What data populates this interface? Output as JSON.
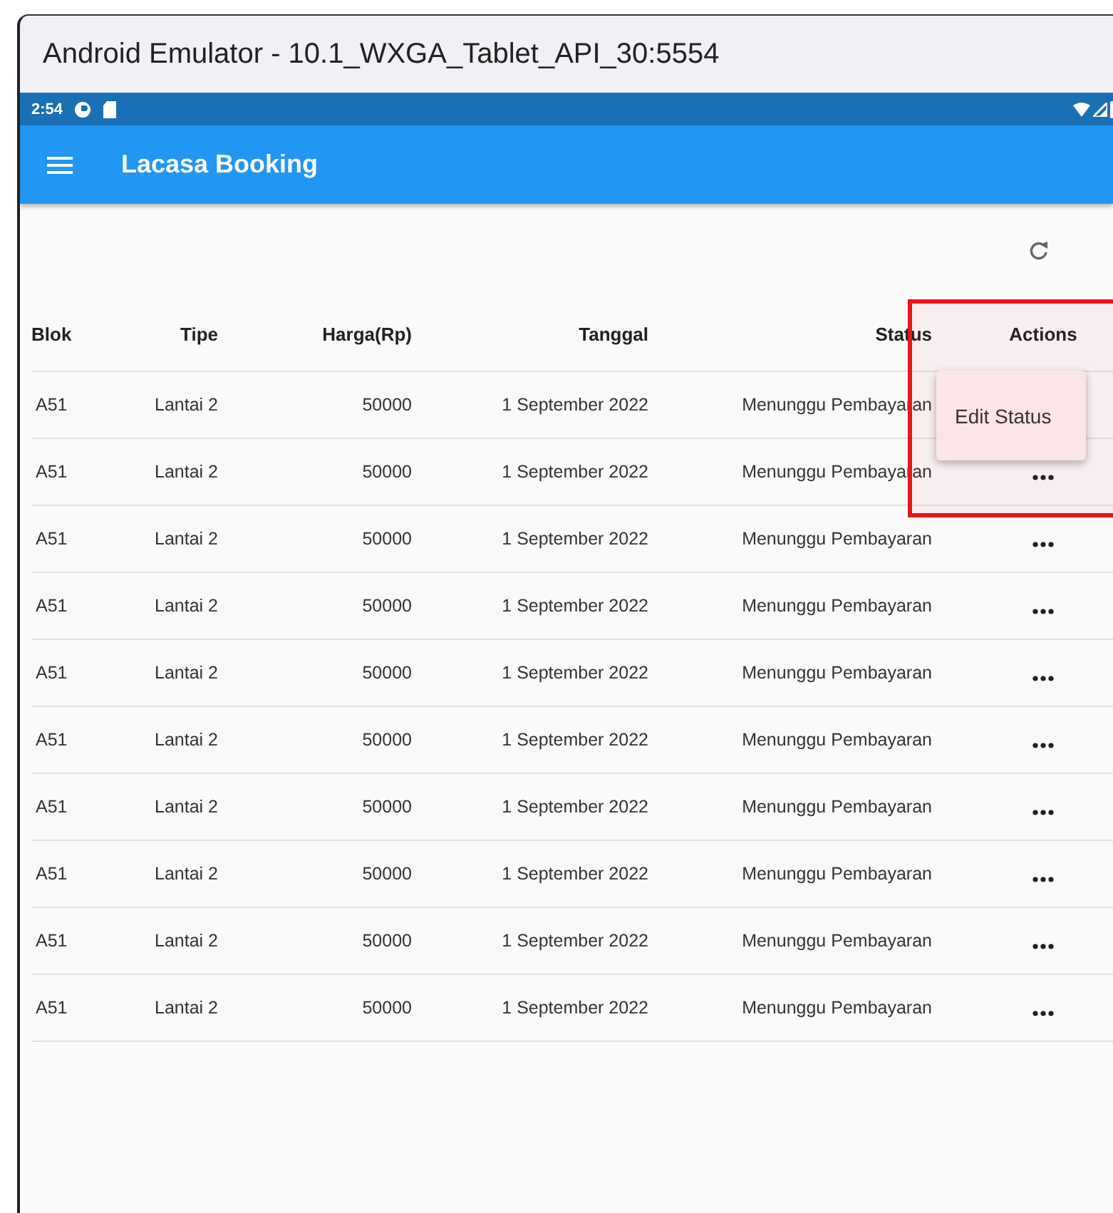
{
  "window": {
    "title": "Android Emulator - 10.1_WXGA_Tablet_API_30:5554"
  },
  "status_bar": {
    "time": "2:54"
  },
  "app_bar": {
    "title": "Lacasa Booking"
  },
  "table": {
    "columns": [
      "Blok",
      "Tipe",
      "Harga(Rp)",
      "Tanggal",
      "Status",
      "Actions"
    ],
    "rows": [
      {
        "cells": [
          "A51",
          "Lantai 2",
          "50000",
          "1 September 2022",
          "Menunggu Pembayaran"
        ],
        "menu_open": true
      },
      {
        "cells": [
          "A51",
          "Lantai 2",
          "50000",
          "1 September 2022",
          "Menunggu Pembayaran"
        ],
        "menu_open": false
      },
      {
        "cells": [
          "A51",
          "Lantai 2",
          "50000",
          "1 September 2022",
          "Menunggu Pembayaran"
        ],
        "menu_open": false
      },
      {
        "cells": [
          "A51",
          "Lantai 2",
          "50000",
          "1 September 2022",
          "Menunggu Pembayaran"
        ],
        "menu_open": false
      },
      {
        "cells": [
          "A51",
          "Lantai 2",
          "50000",
          "1 September 2022",
          "Menunggu Pembayaran"
        ],
        "menu_open": false
      },
      {
        "cells": [
          "A51",
          "Lantai 2",
          "50000",
          "1 September 2022",
          "Menunggu Pembayaran"
        ],
        "menu_open": false
      },
      {
        "cells": [
          "A51",
          "Lantai 2",
          "50000",
          "1 September 2022",
          "Menunggu Pembayaran"
        ],
        "menu_open": false
      },
      {
        "cells": [
          "A51",
          "Lantai 2",
          "50000",
          "1 September 2022",
          "Menunggu Pembayaran"
        ],
        "menu_open": false
      },
      {
        "cells": [
          "A51",
          "Lantai 2",
          "50000",
          "1 September 2022",
          "Menunggu Pembayaran"
        ],
        "menu_open": false
      },
      {
        "cells": [
          "A51",
          "Lantai 2",
          "50000",
          "1 September 2022",
          "Menunggu Pembayaran"
        ],
        "menu_open": false
      }
    ]
  },
  "popup_menu": {
    "items": [
      "Edit Status"
    ]
  },
  "annotation": {
    "kind": "highlight-box",
    "color": "#e8141e"
  }
}
